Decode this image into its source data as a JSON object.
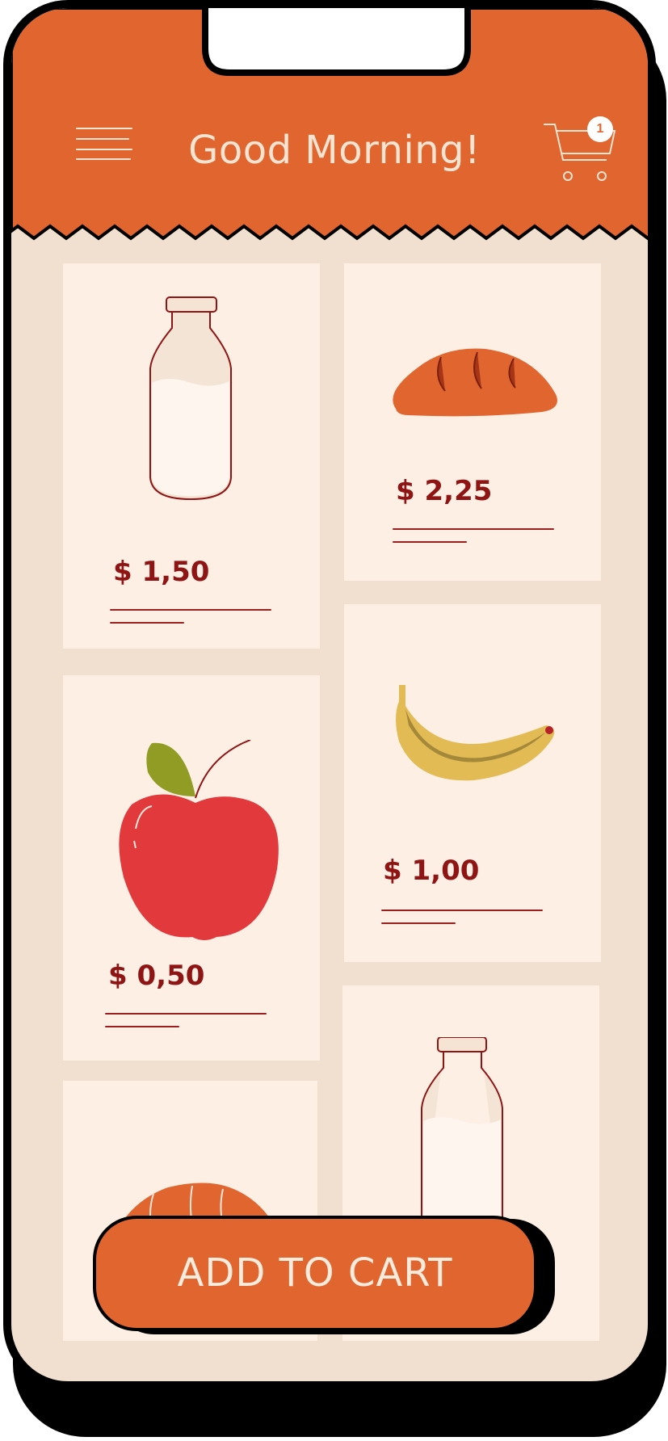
{
  "header": {
    "title": "Good Morning!",
    "cart_count": "1",
    "menu_icon": "hamburger-menu-icon",
    "cart_icon": "shopping-cart-icon"
  },
  "products": [
    {
      "name": "milk bottle",
      "icon": "milk-bottle-icon",
      "price": "$ 1,50"
    },
    {
      "name": "bread",
      "icon": "bread-icon",
      "price": "$ 2,25"
    },
    {
      "name": "apple",
      "icon": "apple-icon",
      "price": "$ 0,50"
    },
    {
      "name": "banana",
      "icon": "banana-icon",
      "price": "$ 1,00"
    },
    {
      "name": "milk bottle",
      "icon": "milk-bottle-icon",
      "price": ""
    },
    {
      "name": "bread",
      "icon": "bread-icon",
      "price": ""
    }
  ],
  "cta": {
    "label": "ADD TO CART"
  },
  "colors": {
    "brand_orange": "#e1652f",
    "background_beige": "#f1e0d0",
    "card": "#fdefe4",
    "price_red": "#8f1414"
  }
}
